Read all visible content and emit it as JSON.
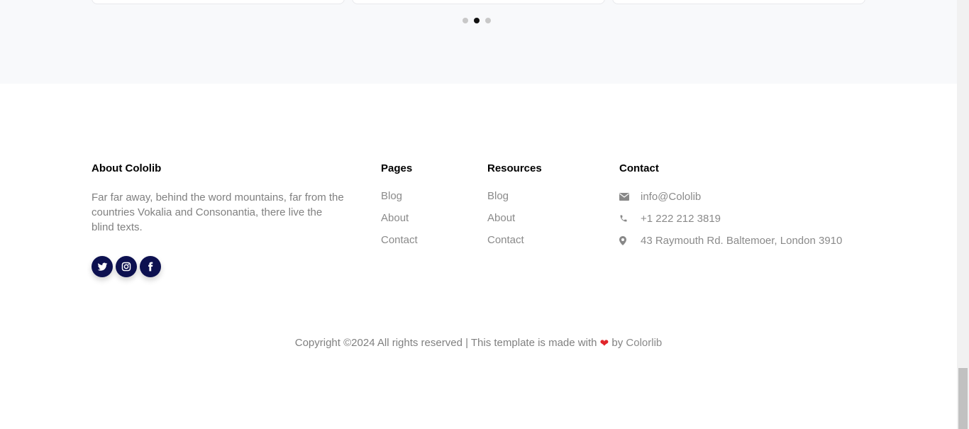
{
  "carousel": {
    "dots": 3,
    "active_index": 1
  },
  "footer": {
    "about": {
      "title": "About Cololib",
      "text": "Far far away, behind the word mountains, far from the countries Vokalia and Consonantia, there live the blind texts."
    },
    "social": [
      "twitter-icon",
      "instagram-icon",
      "facebook-icon"
    ],
    "pages": {
      "title": "Pages",
      "links": [
        "Blog",
        "About",
        "Contact"
      ]
    },
    "resources": {
      "title": "Resources",
      "links": [
        "Blog",
        "About",
        "Contact"
      ]
    },
    "contact": {
      "title": "Contact",
      "email": "info@Cololib",
      "phone": "+1 222 212 3819",
      "address": "43 Raymouth Rd. Baltemoer, London 3910"
    },
    "copyright": {
      "prefix": "Copyright ©2024 All rights reserved | This template is made with",
      "by": "by",
      "brand": "Colorlib"
    }
  },
  "colors": {
    "social_bg": "#0d1150",
    "heart": "#e0262b",
    "band_bg": "#f8f9fb"
  }
}
